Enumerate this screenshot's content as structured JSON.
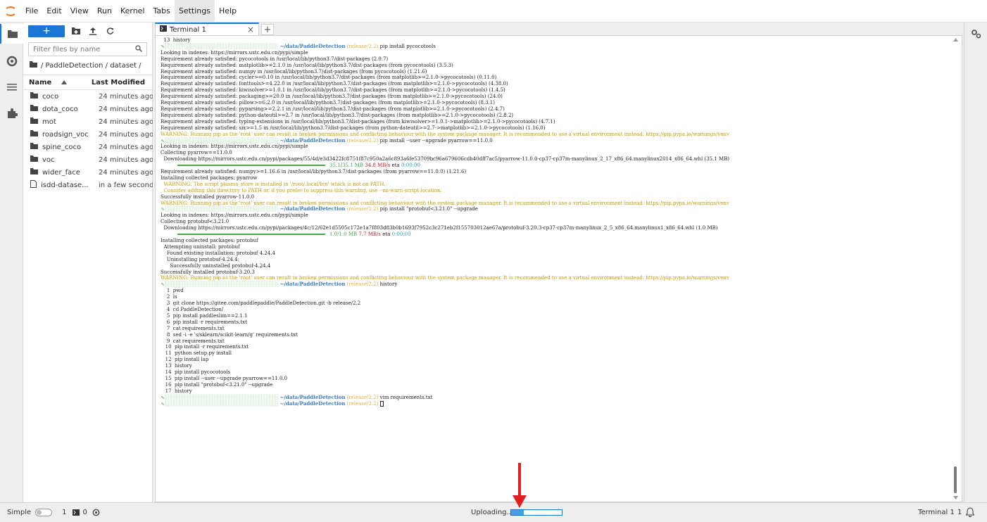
{
  "menu": {
    "items": [
      "File",
      "Edit",
      "View",
      "Run",
      "Kernel",
      "Tabs",
      "Settings",
      "Help"
    ],
    "active": "Settings"
  },
  "filebrowser": {
    "new_label": "+",
    "filter_placeholder": "Filter files by name",
    "breadcrumb": "/ PaddleDetection / dataset /",
    "col_name": "Name",
    "col_modified": "Last Modified",
    "rows": [
      {
        "name": "coco",
        "modified": "24 minutes ago",
        "kind": "folder"
      },
      {
        "name": "dota_coco",
        "modified": "24 minutes ago",
        "kind": "folder"
      },
      {
        "name": "mot",
        "modified": "24 minutes ago",
        "kind": "folder"
      },
      {
        "name": "roadsign_voc",
        "modified": "24 minutes ago",
        "kind": "folder"
      },
      {
        "name": "spine_coco",
        "modified": "24 minutes ago",
        "kind": "folder"
      },
      {
        "name": "voc",
        "modified": "24 minutes ago",
        "kind": "folder"
      },
      {
        "name": "wider_face",
        "modified": "24 minutes ago",
        "kind": "folder"
      },
      {
        "name": "isdd-datase...",
        "modified": "in a few seconds",
        "kind": "file"
      }
    ]
  },
  "tabs": {
    "terminal_label": "Terminal 1",
    "close_glyph": "×",
    "add_glyph": "+"
  },
  "terminal": {
    "path": "~/data/PaddleDetection",
    "branch": "(release/2.2)",
    "lines": [
      {
        "t": "  13  history",
        "c": ""
      },
      {
        "t": "pip install pycocotools",
        "c": "prompt"
      },
      {
        "t": "Looking in indexes: https://mirrors.ustc.edu.cn/pypi/simple",
        "c": ""
      },
      {
        "t": "Requirement already satisfied: pycocotools in /usr/local/lib/python3.7/dist-packages (2.0.7)",
        "c": ""
      },
      {
        "t": "Requirement already satisfied: matplotlib>=2.1.0 in /usr/local/lib/python3.7/dist-packages (from pycocotools) (3.5.3)",
        "c": ""
      },
      {
        "t": "Requirement already satisfied: numpy in /usr/local/lib/python3.7/dist-packages (from pycocotools) (1.21.6)",
        "c": ""
      },
      {
        "t": "Requirement already satisfied: cycler>=0.10 in /usr/local/lib/python3.7/dist-packages (from matplotlib>=2.1.0->pycocotools) (0.11.0)",
        "c": ""
      },
      {
        "t": "Requirement already satisfied: fonttools>=4.22.0 in /usr/local/lib/python3.7/dist-packages (from matplotlib>=2.1.0->pycocotools) (4.38.0)",
        "c": ""
      },
      {
        "t": "Requirement already satisfied: kiwisolver>=1.0.1 in /usr/local/lib/python3.7/dist-packages (from matplotlib>=2.1.0->pycocotools) (1.4.5)",
        "c": ""
      },
      {
        "t": "Requirement already satisfied: packaging>=20.0 in /usr/local/lib/python3.7/dist-packages (from matplotlib>=2.1.0->pycocotools) (24.0)",
        "c": ""
      },
      {
        "t": "Requirement already satisfied: pillow>=6.2.0 in /usr/local/lib/python3.7/dist-packages (from matplotlib>=2.1.0->pycocotools) (8.3.1)",
        "c": ""
      },
      {
        "t": "Requirement already satisfied: pyparsing>=2.2.1 in /usr/local/lib/python3.7/dist-packages (from matplotlib>=2.1.0->pycocotools) (2.4.7)",
        "c": ""
      },
      {
        "t": "Requirement already satisfied: python-dateutil>=2.7 in /usr/local/lib/python3.7/dist-packages (from matplotlib>=2.1.0->pycocotools) (2.8.2)",
        "c": ""
      },
      {
        "t": "Requirement already satisfied: typing-extensions in /usr/local/lib/python3.7/dist-packages (from kiwisolver>=1.0.1->matplotlib>=2.1.0->pycocotools) (4.7.1)",
        "c": ""
      },
      {
        "t": "Requirement already satisfied: six>=1.5 in /usr/local/lib/python3.7/dist-packages (from python-dateutil>=2.7->matplotlib>=2.1.0->pycocotools) (1.16.0)",
        "c": ""
      },
      {
        "t": "WARNING: Running pip as the 'root' user can result in broken permissions and conflicting behaviour with the system package manager. It is recommended to use a virtual environment instead: https://pip.pypa.io/warnings/venv",
        "c": "warn"
      },
      {
        "t": "pip install --user --upgrade pyarrow==11.0.0",
        "c": "prompt"
      },
      {
        "t": "Looking in indexes: https://mirrors.ustc.edu.cn/pypi/simple",
        "c": ""
      },
      {
        "t": "Collecting pyarrow==11.0.0",
        "c": ""
      },
      {
        "t": "  Downloading https://mirrors.ustc.edu.cn/pypi/packages/55/4d/e3d3422fc8751f87c950a2a6c893a6fe53709bc96a679606cdb40dff7ac5/pyarrow-11.0.0-cp37-cp37m-manylinux_2_17_x86_64.manylinux2014_x86_64.whl (35.1 MB)",
        "c": ""
      },
      {
        "t": "35.1/35.1 MB|34.8 MB/s|0:00:00",
        "c": "progress"
      },
      {
        "t": "Requirement already satisfied: numpy>=1.16.6 in /usr/local/lib/python3.7/dist-packages (from pyarrow==11.0.0) (1.21.6)",
        "c": ""
      },
      {
        "t": "Installing collected packages: pyarrow",
        "c": ""
      },
      {
        "t": "  WARNING: The script plasma_store is installed in '/root/.local/bin' which is not on PATH.",
        "c": "warn"
      },
      {
        "t": "  Consider adding this directory to PATH or, if you prefer to suppress this warning, use --no-warn-script-location.",
        "c": "warn"
      },
      {
        "t": "Successfully installed pyarrow-11.0.0",
        "c": ""
      },
      {
        "t": "WARNING: Running pip as the 'root' user can result in broken permissions and conflicting behaviour with the system package manager. It is recommended to use a virtual environment instead: https://pip.pypa.io/warnings/venv",
        "c": "warn"
      },
      {
        "t": "pip install \"protobuf<3.21.0\" --upgrade",
        "c": "prompt"
      },
      {
        "t": "Looking in indexes: https://mirrors.ustc.edu.cn/pypi/simple",
        "c": ""
      },
      {
        "t": "Collecting protobuf<3.21.0",
        "c": ""
      },
      {
        "t": "  Downloading https://mirrors.ustc.edu.cn/pypi/packages/4c/12/62e1d5505c172e1a7f803d83b0b1693f7952c3c271eb2f155703012ae67a/protobuf-3.20.3-cp37-cp37m-manylinux_2_5_x86_64.manylinux1_x86_64.whl (1.0 MB)",
        "c": ""
      },
      {
        "t": "1.0/1.0 MB|7.7 MB/s|0:00:00",
        "c": "progress"
      },
      {
        "t": "Installing collected packages: protobuf",
        "c": ""
      },
      {
        "t": "  Attempting uninstall: protobuf",
        "c": ""
      },
      {
        "t": "    Found existing installation: protobuf 4.24.4",
        "c": ""
      },
      {
        "t": "    Uninstalling protobuf-4.24.4:",
        "c": ""
      },
      {
        "t": "      Successfully uninstalled protobuf-4.24.4",
        "c": ""
      },
      {
        "t": "Successfully installed protobuf-3.20.3",
        "c": ""
      },
      {
        "t": "WARNING: Running pip as the 'root' user can result in broken permissions and conflicting behaviour with the system package manager. It is recommended to use a virtual environment instead: https://pip.pypa.io/warnings/venv",
        "c": "warn"
      },
      {
        "t": "history",
        "c": "prompt"
      },
      {
        "t": "    1  pwd",
        "c": ""
      },
      {
        "t": "    2  ls",
        "c": ""
      },
      {
        "t": "    3  git clone https://gitee.com/paddlepaddle/PaddleDetection.git -b release/2.2",
        "c": ""
      },
      {
        "t": "    4  cd PaddleDetection/",
        "c": ""
      },
      {
        "t": "    5  pip install paddleslim==2.1.1",
        "c": ""
      },
      {
        "t": "    6  pip install -r requirements.txt",
        "c": ""
      },
      {
        "t": "    7  cat requirements.txt",
        "c": ""
      },
      {
        "t": "    8  sed -i -e 's/sklearn/scikit-learn/g' requirements.txt",
        "c": ""
      },
      {
        "t": "    9  cat requirements.txt",
        "c": ""
      },
      {
        "t": "   10  pip install -r requirements.txt",
        "c": ""
      },
      {
        "t": "   11  python setup.py install",
        "c": ""
      },
      {
        "t": "   12  pip install lap",
        "c": ""
      },
      {
        "t": "   13  history",
        "c": ""
      },
      {
        "t": "   14  pip install pycocotools",
        "c": ""
      },
      {
        "t": "   15  pip install --user --upgrade pyarrow==11.0.0",
        "c": ""
      },
      {
        "t": "   16  pip install \"protobuf<3.21.0\" --upgrade",
        "c": ""
      },
      {
        "t": "   17  history",
        "c": ""
      },
      {
        "t": "vim requirements.txt",
        "c": "prompt"
      },
      {
        "t": "",
        "c": "prompt-cursor"
      }
    ]
  },
  "statusbar": {
    "simple_label": "Simple",
    "count_a": "1",
    "count_b": "0",
    "uploading_label": "Uploading...",
    "upload_progress": 0.25,
    "right_label": "Terminal 1",
    "right_count": "1"
  },
  "colors": {
    "accent": "#1976d2",
    "warning_text": "#c89b00",
    "path_text": "#3a7cc4",
    "arrow": "#e02020"
  }
}
